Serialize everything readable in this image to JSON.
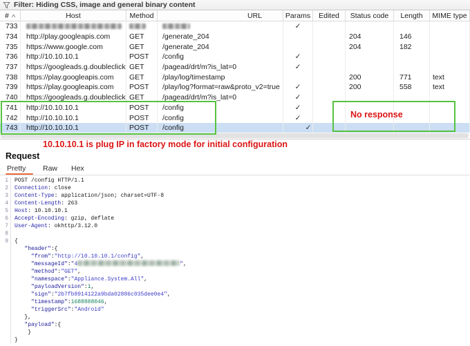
{
  "filter_bar": {
    "label": "Filter: Hiding CSS, image and general binary content"
  },
  "table": {
    "columns": [
      {
        "label": "#",
        "sort": "∧"
      },
      {
        "label": "Host"
      },
      {
        "label": "Method"
      },
      {
        "label": "URL"
      },
      {
        "label": "Params"
      },
      {
        "label": "Edited"
      },
      {
        "label": "Status code"
      },
      {
        "label": "Length"
      },
      {
        "label": "MIME type"
      }
    ],
    "check_glyph": "✓",
    "rows": [
      {
        "id": "733",
        "host": "",
        "method": "",
        "url": "",
        "params": true,
        "status": "",
        "length": "",
        "mime": "",
        "redacted": true
      },
      {
        "id": "734",
        "host": "http://play.googleapis.com",
        "method": "GET",
        "url": "/generate_204",
        "params": false,
        "status": "204",
        "length": "146",
        "mime": ""
      },
      {
        "id": "735",
        "host": "https://www.google.com",
        "method": "GET",
        "url": "/generate_204",
        "params": false,
        "status": "204",
        "length": "182",
        "mime": ""
      },
      {
        "id": "736",
        "host": "http://10.10.10.1",
        "method": "POST",
        "url": "/config",
        "params": true,
        "status": "",
        "length": "",
        "mime": ""
      },
      {
        "id": "737",
        "host": "https://googleads.g.doubleclick...",
        "method": "GET",
        "url": "/pagead/drt/m?is_lat=0",
        "params": true,
        "status": "",
        "length": "",
        "mime": ""
      },
      {
        "id": "738",
        "host": "https://play.googleapis.com",
        "method": "GET",
        "url": "/play/log/timestamp",
        "params": false,
        "status": "200",
        "length": "771",
        "mime": "text"
      },
      {
        "id": "739",
        "host": "https://play.googleapis.com",
        "method": "POST",
        "url": "/play/log?format=raw&proto_v2=true",
        "params": true,
        "status": "200",
        "length": "558",
        "mime": "text"
      },
      {
        "id": "740",
        "host": "https://googleads.g.doubleclick...",
        "method": "GET",
        "url": "/pagead/drt/m?is_lat=0",
        "params": true,
        "status": "",
        "length": "",
        "mime": ""
      },
      {
        "id": "741",
        "host": "http://10.10.10.1",
        "method": "POST",
        "url": "/config",
        "params": true,
        "status": "",
        "length": "",
        "mime": "",
        "highlighted": true
      },
      {
        "id": "742",
        "host": "http://10.10.10.1",
        "method": "POST",
        "url": "/config",
        "params": true,
        "status": "",
        "length": "",
        "mime": "",
        "highlighted": true
      },
      {
        "id": "743",
        "host": "http://10.10.10.1",
        "method": "POST",
        "url": "/config",
        "params": true,
        "status": "",
        "length": "",
        "mime": "",
        "highlighted": true,
        "selected": true
      }
    ]
  },
  "annotations": {
    "no_response": "No response",
    "ip_note": "10.10.10.1 is plug IP in factory mode for initial configuration",
    "highlight_color": "#55c33e",
    "note_color": "#dd1414"
  },
  "request_panel": {
    "title": "Request",
    "tabs": [
      {
        "label": "Pretty",
        "selected": true
      },
      {
        "label": "Raw",
        "selected": false
      },
      {
        "label": "Hex",
        "selected": false
      }
    ],
    "accent_color": "#e8693c",
    "lines": [
      {
        "n": "1",
        "segs": [
          {
            "c": "plain",
            "t": "POST /config HTTP/1.1"
          }
        ]
      },
      {
        "n": "2",
        "segs": [
          {
            "c": "hname",
            "t": "Connection"
          },
          {
            "c": "plain",
            "t": ": close"
          }
        ]
      },
      {
        "n": "3",
        "segs": [
          {
            "c": "hname",
            "t": "Content-Type"
          },
          {
            "c": "plain",
            "t": ": application/json; charset=UTF-8"
          }
        ]
      },
      {
        "n": "4",
        "segs": [
          {
            "c": "hname",
            "t": "Content-Length"
          },
          {
            "c": "plain",
            "t": ": 263"
          }
        ]
      },
      {
        "n": "5",
        "segs": [
          {
            "c": "hname",
            "t": "Host"
          },
          {
            "c": "plain",
            "t": ": 10.10.10.1"
          }
        ]
      },
      {
        "n": "6",
        "segs": [
          {
            "c": "hname",
            "t": "Accept-Encoding"
          },
          {
            "c": "plain",
            "t": ": gzip, deflate"
          }
        ]
      },
      {
        "n": "7",
        "segs": [
          {
            "c": "hname",
            "t": "User-Agent"
          },
          {
            "c": "plain",
            "t": ": okhttp/3.12.0"
          }
        ]
      },
      {
        "n": "8",
        "segs": []
      },
      {
        "n": "9",
        "segs": [
          {
            "c": "plain",
            "t": "{"
          }
        ]
      },
      {
        "n": "",
        "segs": [
          {
            "c": "plain",
            "t": "   "
          },
          {
            "c": "key",
            "t": "\"header\""
          },
          {
            "c": "plain",
            "t": ":{"
          }
        ]
      },
      {
        "n": "",
        "segs": [
          {
            "c": "plain",
            "t": "     "
          },
          {
            "c": "key",
            "t": "\"from\""
          },
          {
            "c": "plain",
            "t": ":"
          },
          {
            "c": "str",
            "t": "\"http://10.10.10.1/config\""
          },
          {
            "c": "plain",
            "t": ","
          }
        ]
      },
      {
        "n": "",
        "segs": [
          {
            "c": "plain",
            "t": "     "
          },
          {
            "c": "key",
            "t": "\"messageId\""
          },
          {
            "c": "plain",
            "t": ":"
          },
          {
            "c": "str",
            "t": "\"4"
          },
          {
            "c": "redact",
            "t": ""
          },
          {
            "c": "str",
            "t": "\""
          },
          {
            "c": "plain",
            "t": ","
          }
        ]
      },
      {
        "n": "",
        "segs": [
          {
            "c": "plain",
            "t": "     "
          },
          {
            "c": "key",
            "t": "\"method\""
          },
          {
            "c": "plain",
            "t": ":"
          },
          {
            "c": "str",
            "t": "\"GET\""
          },
          {
            "c": "plain",
            "t": ","
          }
        ]
      },
      {
        "n": "",
        "segs": [
          {
            "c": "plain",
            "t": "     "
          },
          {
            "c": "key",
            "t": "\"namespace\""
          },
          {
            "c": "plain",
            "t": ":"
          },
          {
            "c": "str",
            "t": "\"Appliance.System.All\""
          },
          {
            "c": "plain",
            "t": ","
          }
        ]
      },
      {
        "n": "",
        "segs": [
          {
            "c": "plain",
            "t": "     "
          },
          {
            "c": "key",
            "t": "\"payloadVersion\""
          },
          {
            "c": "plain",
            "t": ":"
          },
          {
            "c": "num",
            "t": "1"
          },
          {
            "c": "plain",
            "t": ","
          }
        ]
      },
      {
        "n": "",
        "segs": [
          {
            "c": "plain",
            "t": "     "
          },
          {
            "c": "key",
            "t": "\"sign\""
          },
          {
            "c": "plain",
            "t": ":"
          },
          {
            "c": "str",
            "t": "\"2b7fb8914122a9bda02886c035dee0e4\""
          },
          {
            "c": "plain",
            "t": ","
          }
        ]
      },
      {
        "n": "",
        "segs": [
          {
            "c": "plain",
            "t": "     "
          },
          {
            "c": "key",
            "t": "\"timestamp\""
          },
          {
            "c": "plain",
            "t": ":"
          },
          {
            "c": "num",
            "t": "1688888046"
          },
          {
            "c": "plain",
            "t": ","
          }
        ]
      },
      {
        "n": "",
        "segs": [
          {
            "c": "plain",
            "t": "     "
          },
          {
            "c": "key",
            "t": "\"triggerSrc\""
          },
          {
            "c": "plain",
            "t": ":"
          },
          {
            "c": "str",
            "t": "\"Android\""
          }
        ]
      },
      {
        "n": "",
        "segs": [
          {
            "c": "plain",
            "t": "   },"
          }
        ]
      },
      {
        "n": "",
        "segs": [
          {
            "c": "plain",
            "t": "   "
          },
          {
            "c": "key",
            "t": "\"payload\""
          },
          {
            "c": "plain",
            "t": ":{"
          }
        ]
      },
      {
        "n": "",
        "segs": [
          {
            "c": "plain",
            "t": "    }"
          }
        ]
      },
      {
        "n": "",
        "segs": [
          {
            "c": "plain",
            "t": "}"
          }
        ]
      }
    ]
  }
}
